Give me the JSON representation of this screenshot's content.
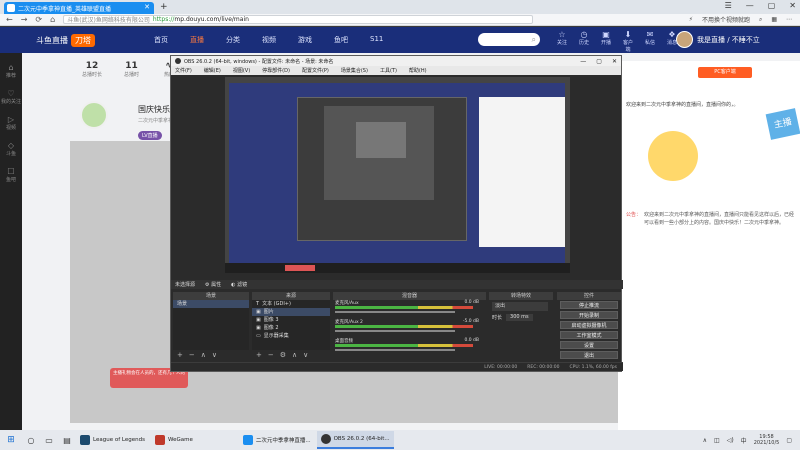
{
  "browser": {
    "tab_title": "二次元中季拿神直播_英雄联盟直播",
    "new_tab": "+",
    "window_controls": [
      "☰",
      "—",
      "▢",
      "✕"
    ],
    "url_prefix": "斗鱼(武汉)鱼网络科技有限公司",
    "url_proto": "https://",
    "url_host": "mp.douyu.com/live/main",
    "right_text": "不用换个视频就跑",
    "nav": [
      "←",
      "→",
      "⟳",
      "⌂"
    ]
  },
  "site": {
    "logo_text": "斗鱼直播",
    "logo_badge": "刀塔",
    "nav": [
      "首页",
      "直播",
      "分类",
      "视频",
      "游戏",
      "鱼吧",
      "S11"
    ],
    "active_nav": 1,
    "head_icons": [
      {
        "icon": "☆",
        "label": "关注"
      },
      {
        "icon": "◷",
        "label": "历史"
      },
      {
        "icon": "▣",
        "label": "开播"
      },
      {
        "icon": "⬇",
        "label": "客户端"
      },
      {
        "icon": "✉",
        "label": "私信"
      },
      {
        "icon": "❖",
        "label": "消息"
      }
    ],
    "user_name": "我是直播 / 不睡不立"
  },
  "left_rail": [
    "推荐",
    "我的关注",
    "视频",
    "斗鱼",
    "鱼吧"
  ],
  "anchor": {
    "stats": [
      {
        "value": "12",
        "label": "总播时长"
      },
      {
        "value": "11",
        "label": "总播时"
      },
      {
        "value": "∿",
        "label": "热度"
      }
    ],
    "title": "国庆快乐，碌谷火",
    "sub": "二次元中季拿神",
    "tag": "LV直播"
  },
  "right_panel": {
    "button": "PC客户端",
    "lead": "欢迎来到二次元中季拿神的直播间，直播间你的，。",
    "stamp": "主播",
    "notice_label": "公告：",
    "notice": "欢迎来到二次元中季拿神的直播间，直播间只能看见这样以后，已经可以看到一些小部分上的内容。国庆中快乐！二次元中季拿神。"
  },
  "hint": "主播礼物会在人员的，还有几个人的",
  "obs": {
    "title": "OBS 26.0.2 (64-bit, windows) - 配置文件: 未命名 - 场景: 未命名",
    "menu": [
      "文件(F)",
      "编辑(E)",
      "视图(V)",
      "停靠部件(D)",
      "配置文件(P)",
      "场景集合(S)",
      "工具(T)",
      "帮助(H)"
    ],
    "scene_bar": [
      "未选择源",
      "属性",
      "滤镜"
    ],
    "docks": [
      "场景",
      "来源",
      "混音器",
      "转场特效",
      "控件"
    ],
    "scenes": [
      "场景"
    ],
    "sources": [
      {
        "icon": "T",
        "label": "文本 (GDI+)"
      },
      {
        "icon": "▣",
        "label": "图片"
      },
      {
        "icon": "▣",
        "label": "图像 3"
      },
      {
        "icon": "▣",
        "label": "图像 2"
      },
      {
        "icon": "▭",
        "label": "显示器采集"
      }
    ],
    "mixer": [
      {
        "name": "麦克风/Aux",
        "db": "0.0 dB"
      },
      {
        "name": "麦克风/Aux 2",
        "db": "-5.0 dB"
      },
      {
        "name": "桌面音频",
        "db": "0.0 dB"
      }
    ],
    "transition": {
      "selected": "淡出",
      "duration_label": "时长",
      "duration": "300 ms"
    },
    "controls": [
      "停止推流",
      "开始录制",
      "启动虚拟摄像机",
      "工作室模式",
      "设置",
      "退出"
    ],
    "status": [
      "LIVE: 00:00:00",
      "REC: 00:00:00",
      "CPU: 1.1%, 60.00 fps"
    ]
  },
  "taskbar": {
    "apps": [
      {
        "label": "League of Legends",
        "color": "#1c4a6e",
        "active": false
      },
      {
        "label": "WeGame",
        "color": "#c0392b",
        "active": false
      },
      {
        "label": "二次元中季拿神直播...",
        "color": "#1a8ef0",
        "active": false
      },
      {
        "label": "OBS 26.0.2 (64-bit...",
        "color": "#333333",
        "active": true
      }
    ],
    "time": "19:58",
    "date": "2021/10/5"
  },
  "colors": {
    "accent": "#1a8ef0",
    "site_header": "#1a2e7a",
    "active_nav": "#ff7a3d"
  }
}
